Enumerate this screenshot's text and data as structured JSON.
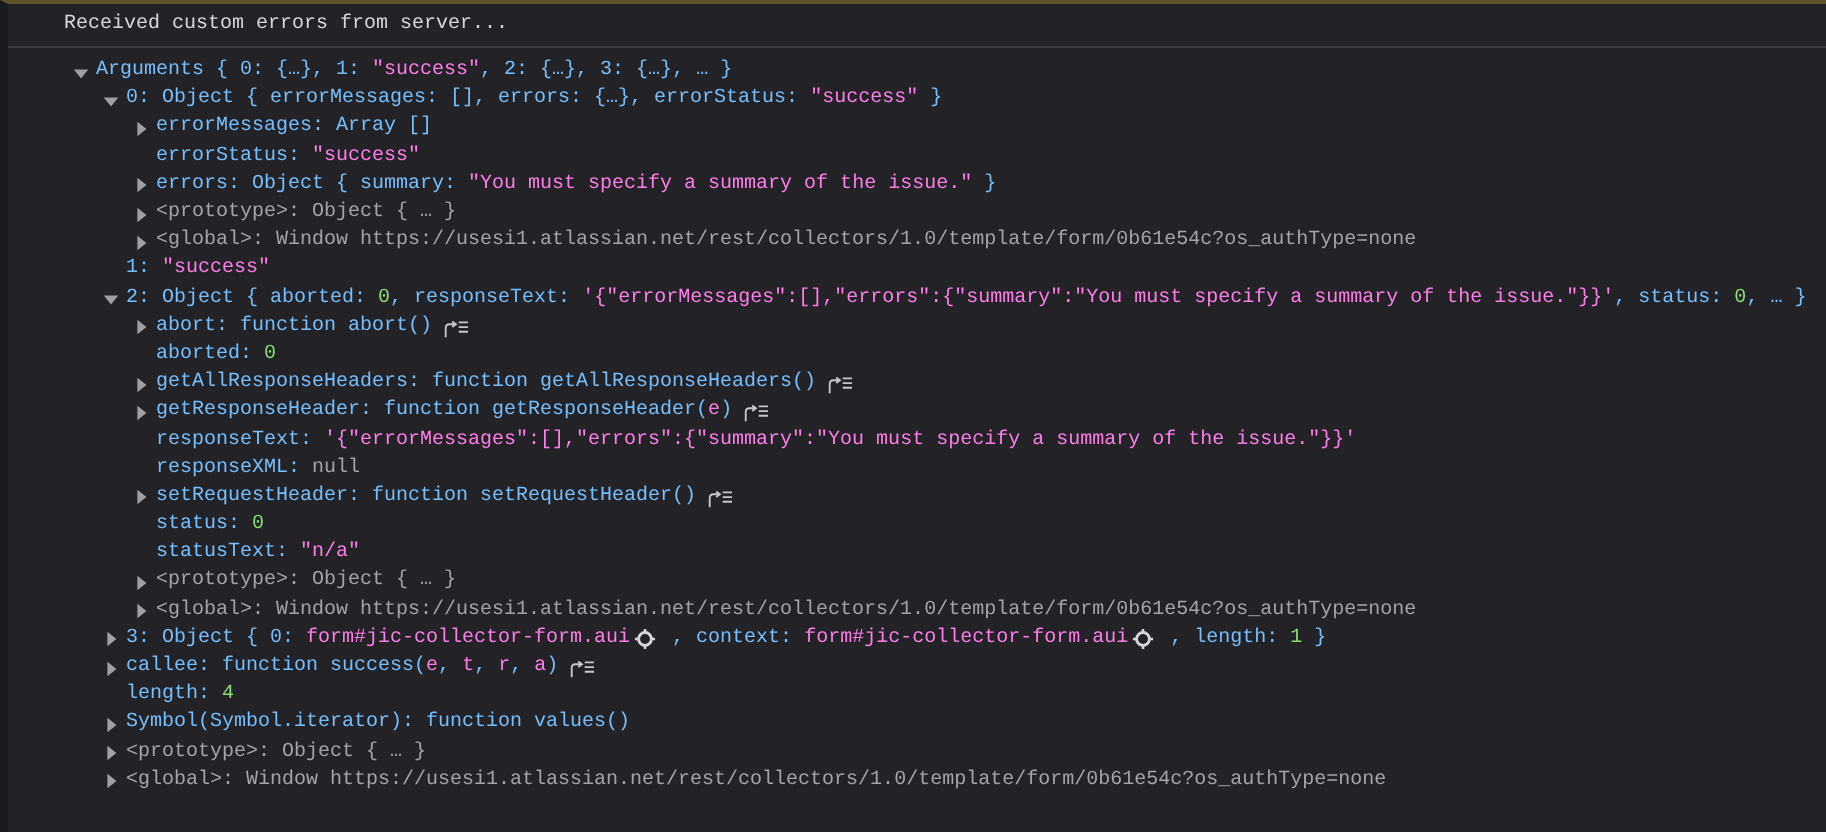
{
  "console": {
    "message": "Received custom errors from server...",
    "tree": {
      "kind": "expandable",
      "expanded": true,
      "segments": [
        {
          "kind": "key",
          "text": "Arguments { 0: {…}, 1: "
        },
        {
          "kind": "str",
          "text": "\"success\""
        },
        {
          "kind": "key",
          "text": ", 2: {…}, 3: {…}, … }"
        }
      ],
      "children": [
        {
          "kind": "expandable",
          "expanded": true,
          "segments": [
            {
              "kind": "key",
              "text": "0: Object { errorMessages: [], errors: {…}, errorStatus: "
            },
            {
              "kind": "str",
              "text": "\"success\""
            },
            {
              "kind": "key",
              "text": " }"
            }
          ],
          "children": [
            {
              "kind": "expandable",
              "expanded": false,
              "segments": [
                {
                  "kind": "key",
                  "text": "errorMessages: Array []"
                }
              ]
            },
            {
              "kind": "leaf",
              "segments": [
                {
                  "kind": "key",
                  "text": "errorStatus: "
                },
                {
                  "kind": "str",
                  "text": "\"success\""
                }
              ]
            },
            {
              "kind": "expandable",
              "expanded": false,
              "segments": [
                {
                  "kind": "key",
                  "text": "errors: Object { summary: "
                },
                {
                  "kind": "str",
                  "text": "\"You must specify a summary of the issue.\""
                },
                {
                  "kind": "key",
                  "text": " }"
                }
              ]
            },
            {
              "kind": "expandable",
              "expanded": false,
              "segments": [
                {
                  "kind": "muted",
                  "text": "<prototype>: Object { … }"
                }
              ]
            },
            {
              "kind": "expandable",
              "expanded": false,
              "segments": [
                {
                  "kind": "muted",
                  "text": "<global>: Window https://usesi1.atlassian.net/rest/collectors/1.0/template/form/0b61e54c?os_authType=none"
                }
              ]
            }
          ]
        },
        {
          "kind": "leaf",
          "segments": [
            {
              "kind": "key",
              "text": "1: "
            },
            {
              "kind": "str",
              "text": "\"success\""
            }
          ]
        },
        {
          "kind": "expandable",
          "expanded": true,
          "segments": [
            {
              "kind": "key",
              "text": "2: Object { aborted: "
            },
            {
              "kind": "num",
              "text": "0"
            },
            {
              "kind": "key",
              "text": ", responseText: "
            },
            {
              "kind": "str",
              "text": "'{\"errorMessages\":[],\"errors\":{\"summary\":\"You must specify a summary of the issue.\"}}'"
            },
            {
              "kind": "key",
              "text": ", status: "
            },
            {
              "kind": "num",
              "text": "0"
            },
            {
              "kind": "key",
              "text": ", … }"
            }
          ],
          "children": [
            {
              "kind": "expandable",
              "expanded": false,
              "jump": true,
              "segments": [
                {
                  "kind": "key",
                  "text": "abort: function abort()"
                }
              ]
            },
            {
              "kind": "leaf",
              "segments": [
                {
                  "kind": "key",
                  "text": "aborted: "
                },
                {
                  "kind": "num",
                  "text": "0"
                }
              ]
            },
            {
              "kind": "expandable",
              "expanded": false,
              "jump": true,
              "segments": [
                {
                  "kind": "key",
                  "text": "getAllResponseHeaders: function getAllResponseHeaders()"
                }
              ]
            },
            {
              "kind": "expandable",
              "expanded": false,
              "jump": true,
              "segments": [
                {
                  "kind": "key",
                  "text": "getResponseHeader: function getResponseHeader("
                },
                {
                  "kind": "str",
                  "text": "e"
                },
                {
                  "kind": "key",
                  "text": ")"
                }
              ]
            },
            {
              "kind": "leaf",
              "segments": [
                {
                  "kind": "key",
                  "text": "responseText: "
                },
                {
                  "kind": "str",
                  "text": "'{\"errorMessages\":[],\"errors\":{\"summary\":\"You must specify a summary of the issue.\"}}'"
                }
              ]
            },
            {
              "kind": "leaf",
              "segments": [
                {
                  "kind": "key",
                  "text": "responseXML: "
                },
                {
                  "kind": "muted",
                  "text": "null"
                }
              ]
            },
            {
              "kind": "expandable",
              "expanded": false,
              "jump": true,
              "segments": [
                {
                  "kind": "key",
                  "text": "setRequestHeader: function setRequestHeader()"
                }
              ]
            },
            {
              "kind": "leaf",
              "segments": [
                {
                  "kind": "key",
                  "text": "status: "
                },
                {
                  "kind": "num",
                  "text": "0"
                }
              ]
            },
            {
              "kind": "leaf",
              "segments": [
                {
                  "kind": "key",
                  "text": "statusText: "
                },
                {
                  "kind": "str",
                  "text": "\"n/a\""
                }
              ]
            },
            {
              "kind": "expandable",
              "expanded": false,
              "segments": [
                {
                  "kind": "muted",
                  "text": "<prototype>: Object { … }"
                }
              ]
            },
            {
              "kind": "expandable",
              "expanded": false,
              "segments": [
                {
                  "kind": "muted",
                  "text": "<global>: Window https://usesi1.atlassian.net/rest/collectors/1.0/template/form/0b61e54c?os_authType=none"
                }
              ]
            }
          ]
        },
        {
          "kind": "expandable",
          "expanded": false,
          "segments": [
            {
              "kind": "key",
              "text": "3: Object { 0: "
            },
            {
              "kind": "node",
              "text": "form#jic-collector-form.aui"
            },
            {
              "kind": "key",
              "text": " , context: "
            },
            {
              "kind": "node",
              "text": "form#jic-collector-form.aui"
            },
            {
              "kind": "key",
              "text": " , length: "
            },
            {
              "kind": "num",
              "text": "1"
            },
            {
              "kind": "key",
              "text": " }"
            }
          ]
        },
        {
          "kind": "expandable",
          "expanded": false,
          "jump": true,
          "segments": [
            {
              "kind": "key",
              "text": "callee: function success("
            },
            {
              "kind": "str",
              "text": "e"
            },
            {
              "kind": "key",
              "text": ", "
            },
            {
              "kind": "str",
              "text": "t"
            },
            {
              "kind": "key",
              "text": ", "
            },
            {
              "kind": "str",
              "text": "r"
            },
            {
              "kind": "key",
              "text": ", "
            },
            {
              "kind": "str",
              "text": "a"
            },
            {
              "kind": "key",
              "text": ")"
            }
          ]
        },
        {
          "kind": "leaf",
          "segments": [
            {
              "kind": "key",
              "text": "length: "
            },
            {
              "kind": "num",
              "text": "4"
            }
          ]
        },
        {
          "kind": "expandable",
          "expanded": false,
          "segments": [
            {
              "kind": "key",
              "text": "Symbol(Symbol.iterator): function values()"
            }
          ]
        },
        {
          "kind": "expandable",
          "expanded": false,
          "segments": [
            {
              "kind": "muted",
              "text": "<prototype>: Object { … }"
            }
          ]
        },
        {
          "kind": "expandable",
          "expanded": false,
          "segments": [
            {
              "kind": "muted",
              "text": "<global>: Window https://usesi1.atlassian.net/rest/collectors/1.0/template/form/0b61e54c?os_authType=none"
            }
          ]
        }
      ]
    }
  }
}
